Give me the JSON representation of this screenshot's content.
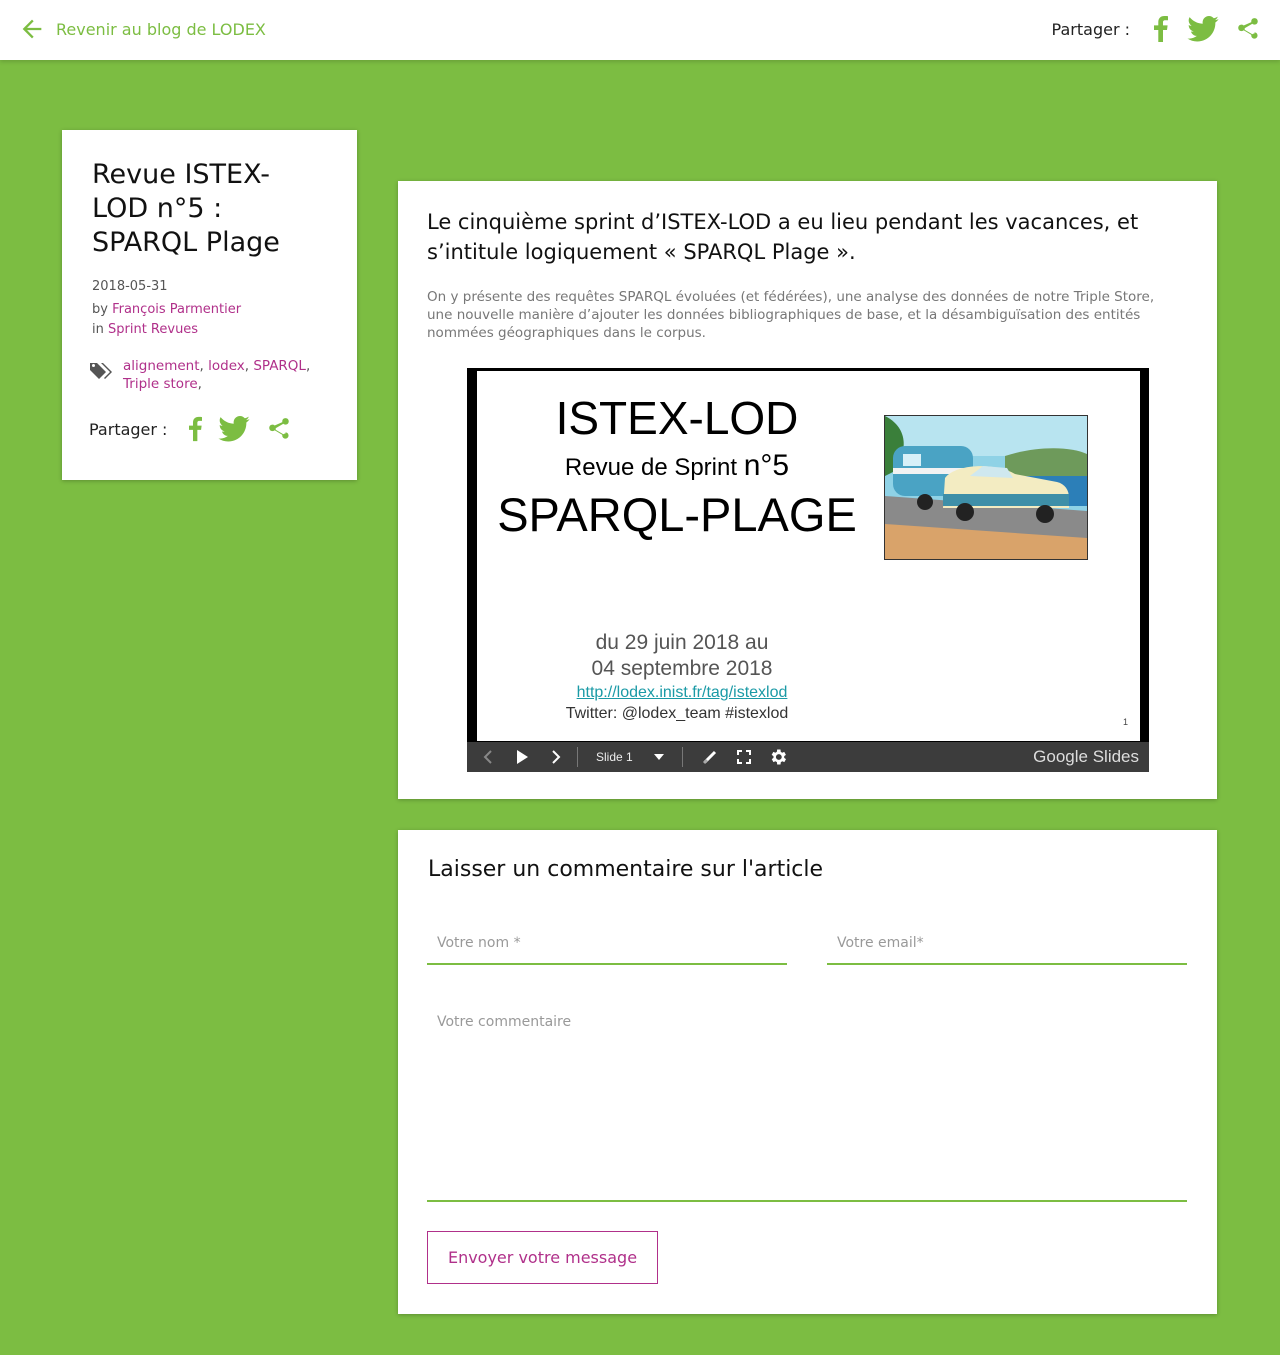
{
  "topbar": {
    "back_label": "Revenir au blog de LODEX",
    "share_label": "Partager :"
  },
  "colors": {
    "accent": "#7cbd42",
    "link": "#b0308a"
  },
  "post": {
    "title": "Revue ISTEX-LOD n°5 : SPARQL Plage",
    "date": "2018-05-31",
    "by_prefix": "by",
    "author": "François Parmentier",
    "in_prefix": "in",
    "category": "Sprint Revues",
    "tags": [
      "alignement",
      "lodex",
      "SPARQL",
      "Triple store"
    ],
    "share_label": "Partager :"
  },
  "article": {
    "lead": "Le cinquième sprint d’ISTEX-LOD a eu lieu pendant les vacances, et s’intitule logiquement « SPARQL Plage ».",
    "description": "On y présente des requêtes SPARQL évoluées (et fédérées), une analyse des données de notre Triple Store, une nouvelle manière d’ajouter les données bibliographiques de base, et la désambiguïsation des entités nommées géographiques dans le corpus."
  },
  "slide": {
    "title": "ISTEX-LOD",
    "subtitle_prefix": "Revue de Sprint",
    "subtitle_number": "n°5",
    "name": "SPARQL-PLAGE",
    "date_line1": "du 29 juin 2018 au",
    "date_line2": "04 septembre 2018",
    "link": "http://lodex.inist.fr/tag/istexlod",
    "twitter": "Twitter: @lodex_team #istexlod",
    "page_number": "1"
  },
  "slides_controls": {
    "current_slide": "Slide 1",
    "brand": "Google Slides"
  },
  "comment_form": {
    "title": "Laisser un commentaire sur l'article",
    "name_placeholder": "Votre nom *",
    "email_placeholder": "Votre email*",
    "comment_placeholder": "Votre commentaire",
    "submit_label": "Envoyer votre message"
  },
  "icons": [
    "arrow-left-icon",
    "facebook-icon",
    "twitter-icon",
    "share-icon",
    "tag-icon",
    "chevron-left-icon",
    "play-icon",
    "chevron-right-icon",
    "dropdown-icon",
    "pointer-icon",
    "fullscreen-icon",
    "gear-icon"
  ]
}
